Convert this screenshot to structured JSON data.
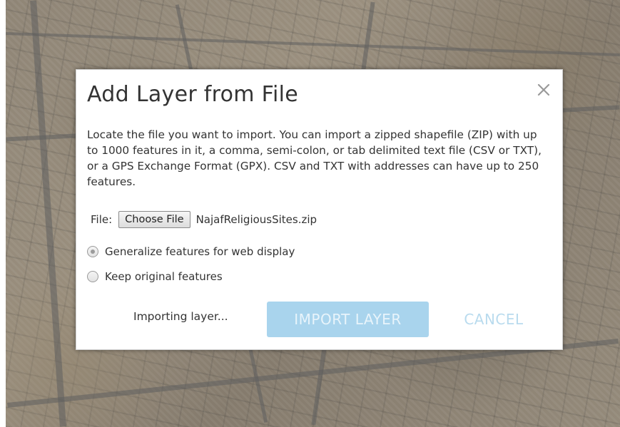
{
  "dialog": {
    "title": "Add Layer from File",
    "close_icon": "close-icon",
    "description": "Locate the file you want to import. You can import a zipped shapefile (ZIP) with up to 1000 features in it, a comma, semi-colon, or tab delimited text file (CSV or TXT), or a GPS Exchange Format (GPX). CSV and TXT with addresses can have up to 250 features.",
    "file": {
      "label": "File:",
      "choose_button": "Choose File",
      "selected_file": "NajafReligiousSites.zip"
    },
    "options": [
      {
        "label": "Generalize features for web display",
        "checked": true
      },
      {
        "label": "Keep original features",
        "checked": false
      }
    ],
    "status": "Importing layer...",
    "import_button": "IMPORT LAYER",
    "cancel_button": "CANCEL"
  },
  "colors": {
    "import_button_bg": "#a9d4ed",
    "cancel_text": "#b9dbee",
    "text": "#333333"
  }
}
